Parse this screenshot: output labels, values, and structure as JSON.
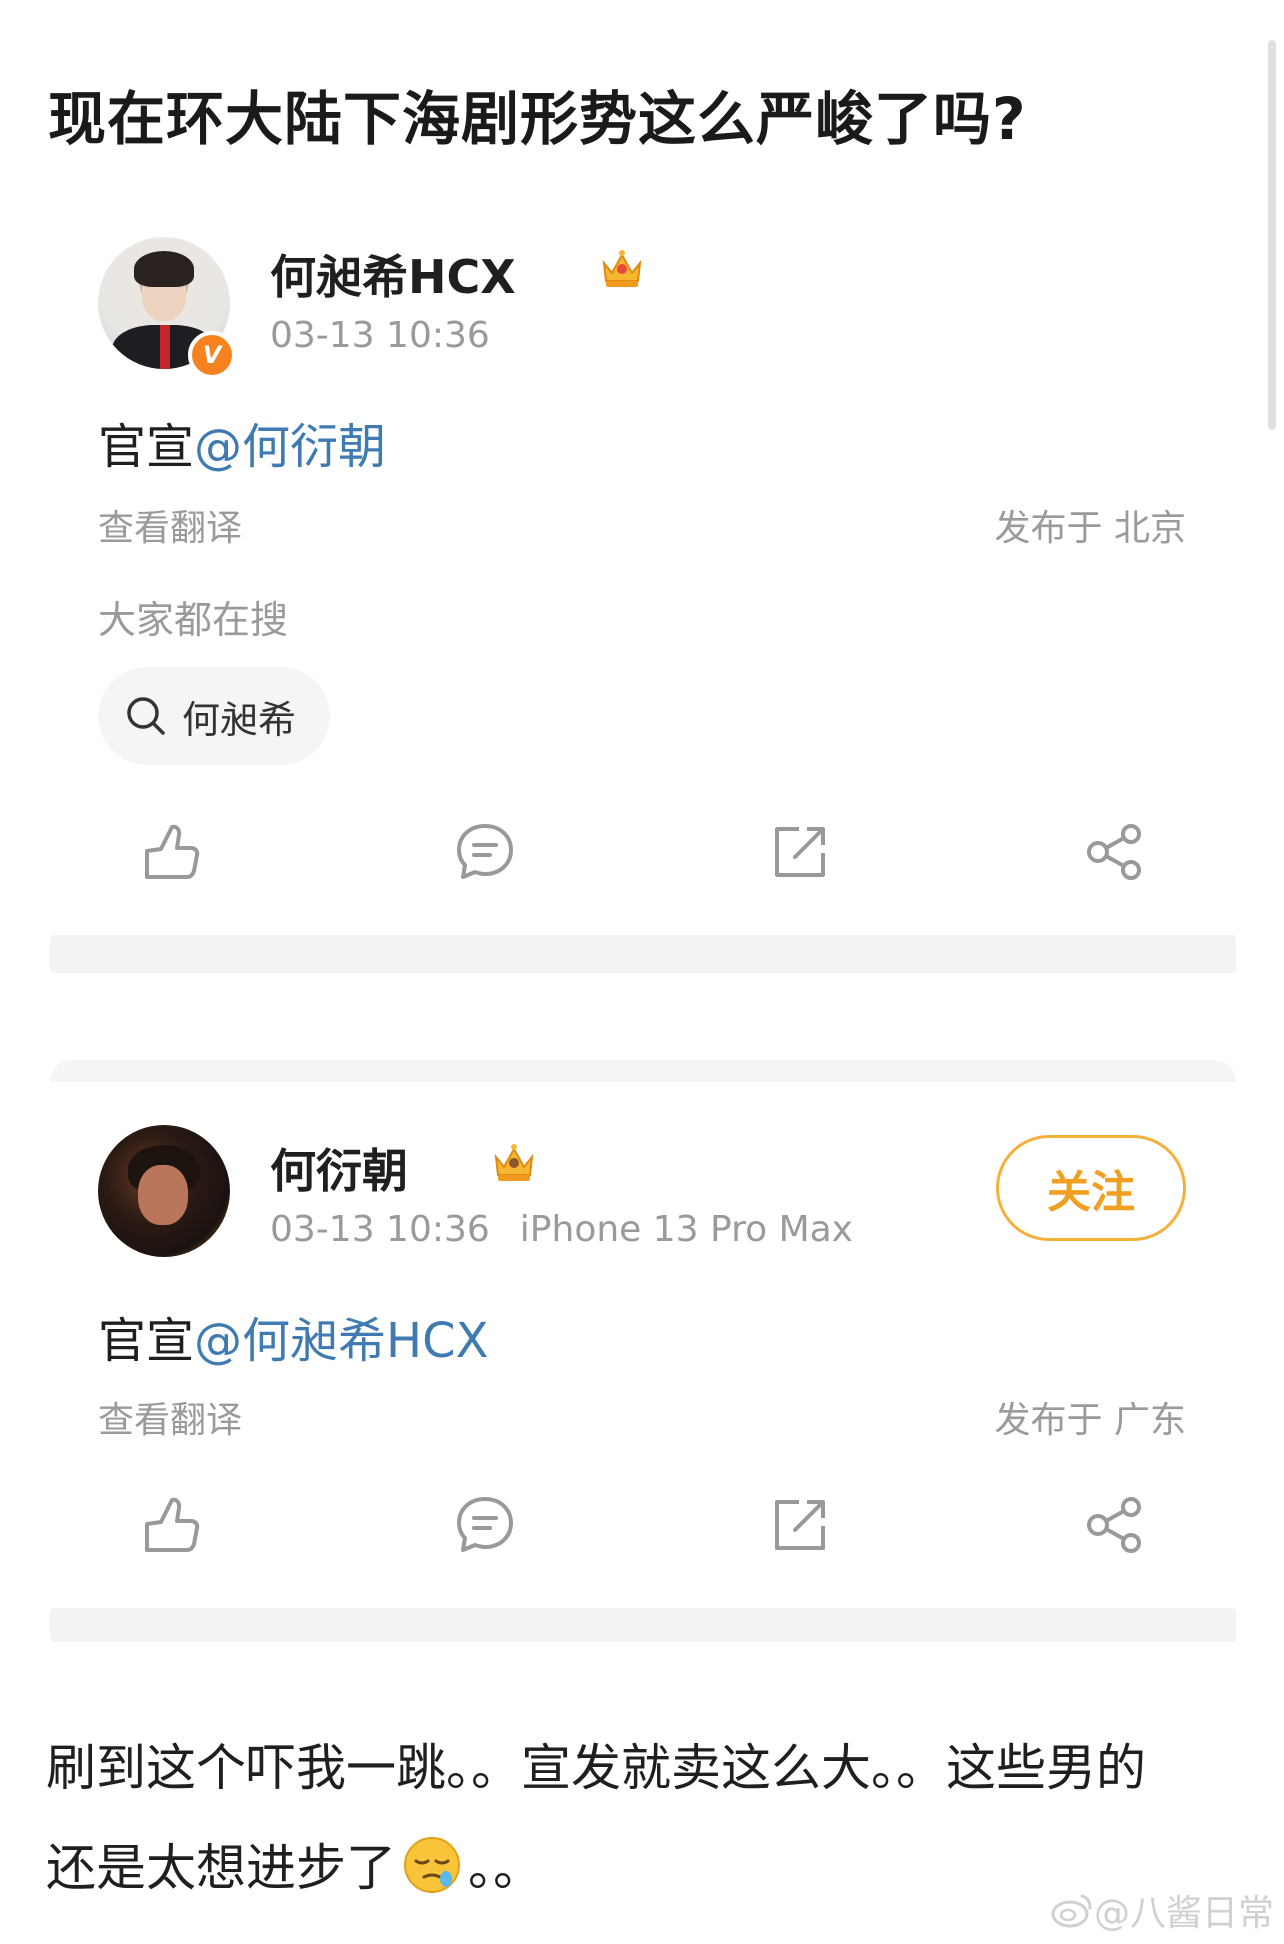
{
  "post": {
    "title": "现在环大陆下海剧形势这么严峻了吗?"
  },
  "card1": {
    "username": "何昶希HCX",
    "timestamp": "03-13 10:36",
    "content_prefix": "官宣",
    "mention": "@何衍朝",
    "translate": "查看翻译",
    "location": "发布于 北京",
    "hot_label": "大家都在搜",
    "search_chip": "何昶希",
    "verified_badge": "V",
    "icons": [
      "like-icon",
      "comment-icon",
      "repost-icon",
      "share-icon"
    ]
  },
  "card2": {
    "username": "何衍朝",
    "timestamp": "03-13 10:36",
    "device": "iPhone 13 Pro Max",
    "follow": "关注",
    "content_prefix": "官宣",
    "mention": "@何昶希HCX",
    "translate": "查看翻译",
    "location": "发布于 广东",
    "icons": [
      "like-icon",
      "comment-icon",
      "repost-icon",
      "share-icon"
    ]
  },
  "comment": {
    "line1": "刷到这个吓我一跳。。宣发就卖这么大。。这些男的",
    "line2_before": "还是太想进步了",
    "line2_after": "。。",
    "emoji": "sleepy-face-emoji"
  },
  "watermark": "@八酱日常",
  "colors": {
    "accent_blue": "#3f7bb2",
    "follow_orange": "#f0a020",
    "verified_orange": "#f6821f",
    "meta_gray": "#9a9a9a"
  }
}
